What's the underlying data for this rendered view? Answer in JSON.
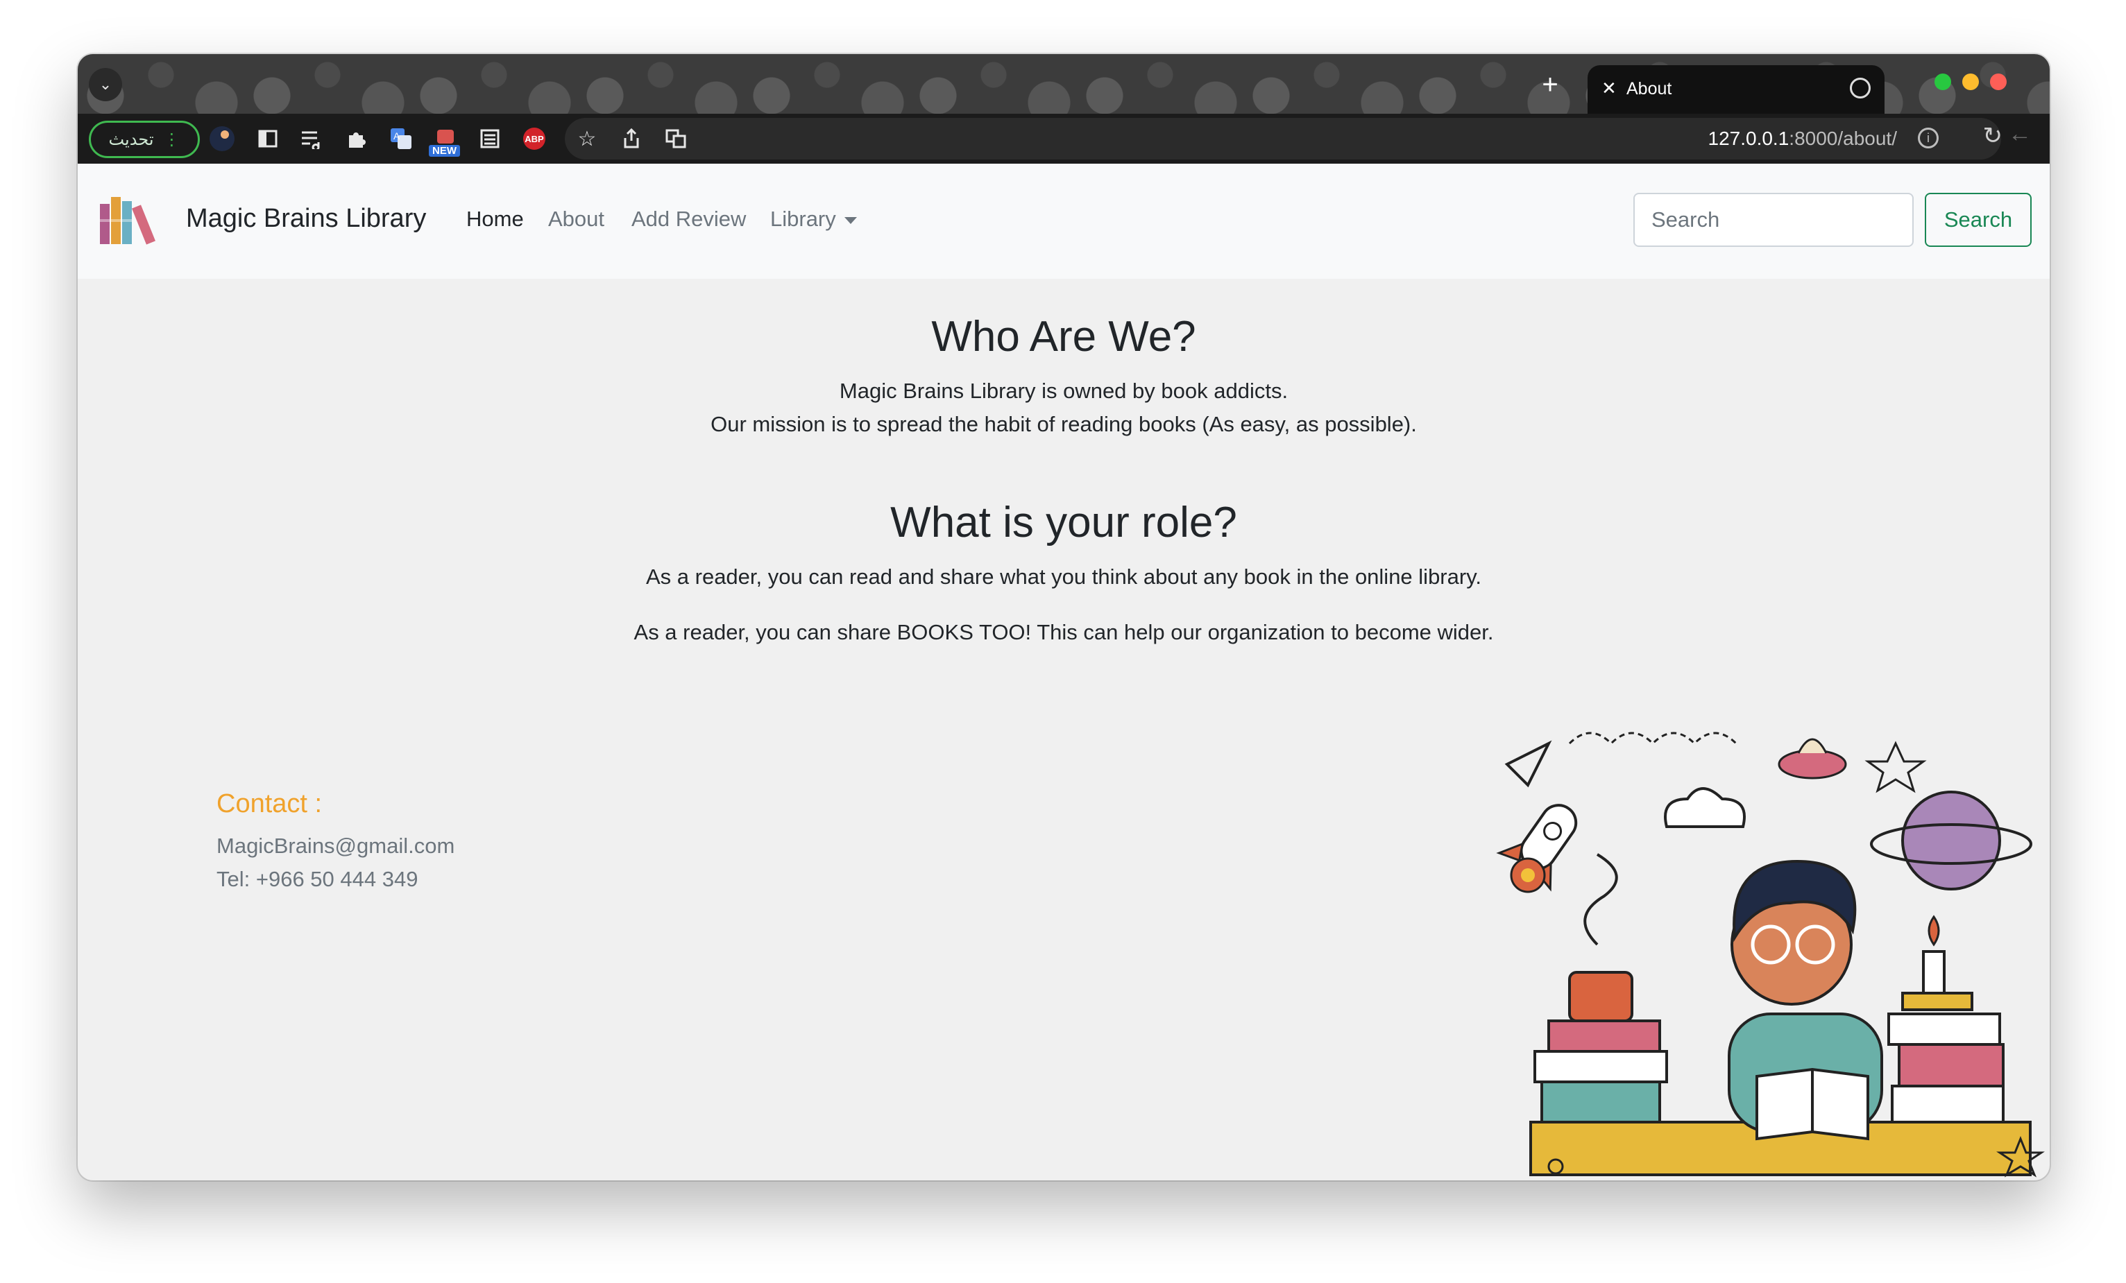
{
  "browser": {
    "update_label": "تحديث",
    "tab_title": "About",
    "url_host": "127.0.0.1",
    "url_rest": ":8000/about/",
    "new_badge": "NEW",
    "abp_label": "ABP"
  },
  "navbar": {
    "brand": "Magic Brains Library",
    "links": [
      "Home",
      "About",
      "Add Review",
      "Library"
    ],
    "search_placeholder": "Search",
    "search_button": "Search"
  },
  "about": {
    "heading": "Who Are We?",
    "line1": "Magic Brains Library is owned by book addicts.",
    "line2": "Our mission is to spread the habit of reading books (As easy, as possible)."
  },
  "role": {
    "heading": "What is your role?",
    "line1": "As a reader, you can read and share what you think about any book in the online library.",
    "line2": "As a reader, you can share BOOKS TOO! This can help our organization to become wider."
  },
  "contact": {
    "title": "Contact :",
    "email": "MagicBrains@gmail.com",
    "tel": "Tel: +966 50 444 349"
  },
  "colors": {
    "accent_contact": "#f0a22c",
    "success": "#198754"
  }
}
